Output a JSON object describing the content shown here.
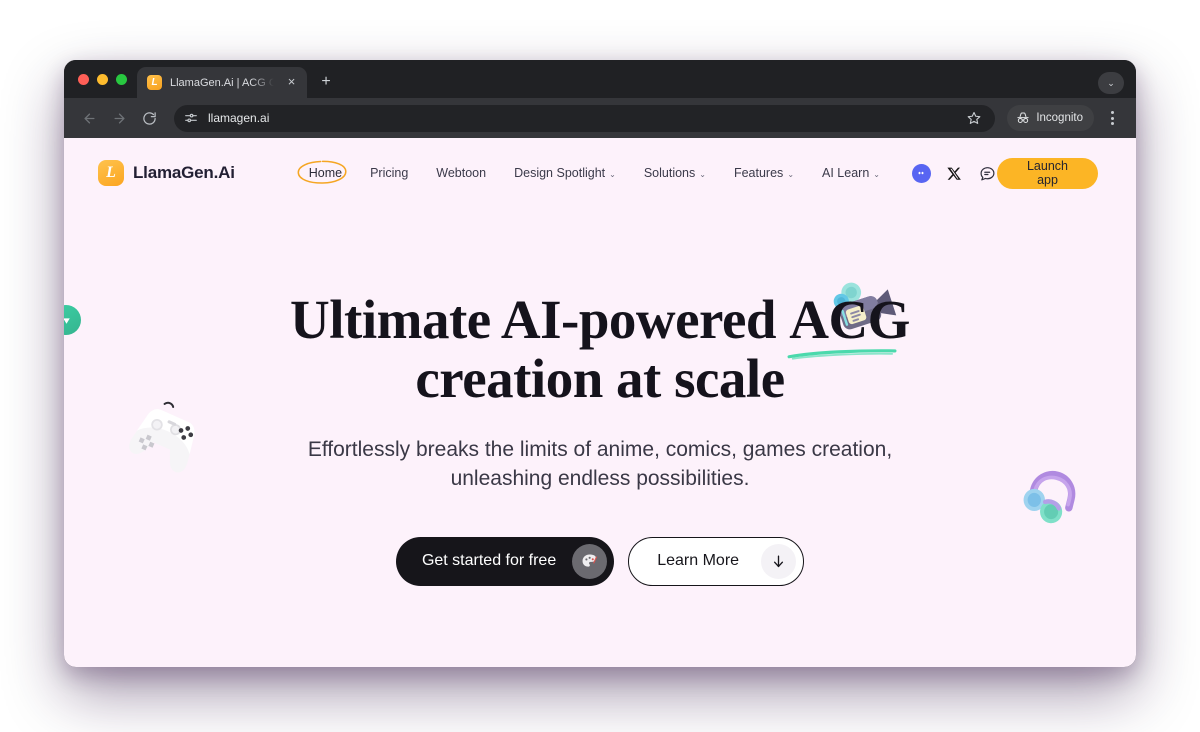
{
  "browser": {
    "tab": {
      "title": "LlamaGen.Ai | ACG Copilot fo",
      "favicon_letter": "L",
      "close_label": "×",
      "new_tab_label": "+"
    },
    "toolbar": {
      "back_label": "back-arrow",
      "forward_label": "forward-arrow",
      "reload_label": "reload",
      "url": "llamagen.ai",
      "incognito_label": "Incognito",
      "tabstrip_chevron": "⌄"
    }
  },
  "site": {
    "brand": {
      "mark_letter": "L",
      "name": "LlamaGen.Ai"
    },
    "nav": [
      {
        "label": "Home",
        "has_chevron": false,
        "active": true
      },
      {
        "label": "Pricing",
        "has_chevron": false,
        "active": false
      },
      {
        "label": "Webtoon",
        "has_chevron": false,
        "active": false
      },
      {
        "label": "Design Spotlight",
        "has_chevron": true,
        "active": false
      },
      {
        "label": "Solutions",
        "has_chevron": true,
        "active": false
      },
      {
        "label": "Features",
        "has_chevron": true,
        "active": false
      },
      {
        "label": "AI Learn",
        "has_chevron": true,
        "active": false
      }
    ],
    "chevron_glyph": "⌄",
    "social": [
      {
        "name": "discord"
      },
      {
        "name": "x-twitter"
      },
      {
        "name": "chat"
      }
    ],
    "launch_app_label": "Launch app"
  },
  "hero": {
    "title_line1_pre": "Ultimate AI-powered ",
    "title_highlight": "ACG",
    "title_line2": "creation at scale",
    "subtitle_line1": "Effortlessly breaks the limits of anime, comics, games creation,",
    "subtitle_line2": "unleashing endless possibilities.",
    "primary_cta": "Get started for free",
    "secondary_cta": "Learn More"
  },
  "colors": {
    "brand_orange": "#fcb525",
    "underline_green": "#4bd9ac",
    "page_bg": "#fdf2fb",
    "primary_btn": "#16151a",
    "discord_purple": "#5865f2",
    "pull_tab_green": "#3ccfa4"
  }
}
